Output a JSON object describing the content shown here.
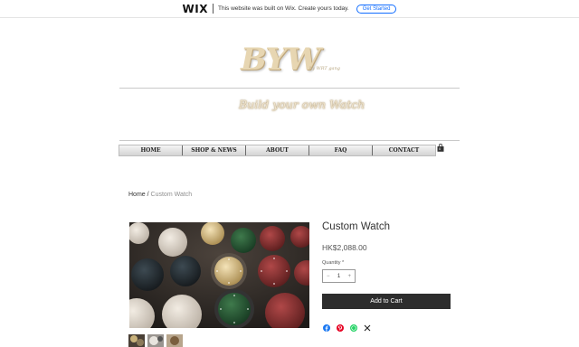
{
  "banner": {
    "logo": "WIX",
    "text": "This website was built on Wix. Create yours today.",
    "cta": "Get Started"
  },
  "header": {
    "logo_text": "BYW",
    "logo_subtext": "by WRT gang",
    "tagline": "Build your own Watch"
  },
  "nav": {
    "items": [
      {
        "label": "HOME"
      },
      {
        "label": "SHOP & NEWS"
      },
      {
        "label": "ABOUT"
      },
      {
        "label": "FAQ"
      },
      {
        "label": "CONTACT"
      }
    ],
    "cart_count": "0"
  },
  "breadcrumb": {
    "home": "Home",
    "separator": " / ",
    "current": "Custom Watch"
  },
  "product": {
    "title": "Custom Watch",
    "price": "HK$2,088.00",
    "quantity_label": "Quantity *",
    "quantity_value": "1",
    "quantity_minus": "−",
    "quantity_plus": "+",
    "add_to_cart": "Add to Cart"
  },
  "share_icons": [
    "facebook-icon",
    "pinterest-icon",
    "whatsapp-icon",
    "x-twitter-icon"
  ],
  "colors": {
    "accent_button": "#2d2d2d",
    "wix_blue": "#116dff",
    "logo_gold": "#e7d6b2"
  }
}
